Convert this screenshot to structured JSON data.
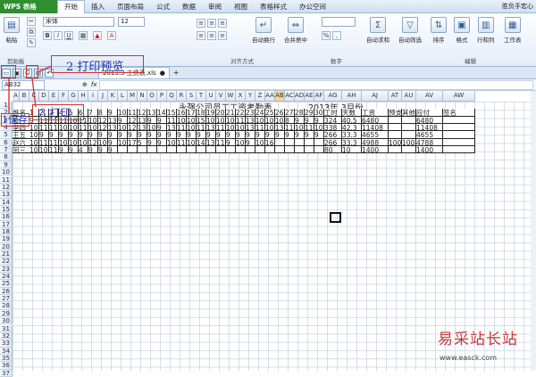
{
  "app": {
    "name": "WPS 表格"
  },
  "menu": {
    "tabs": [
      "开始",
      "插入",
      "页面布局",
      "公式",
      "数据",
      "审阅",
      "视图",
      "表格样式",
      "办公空间"
    ],
    "right": [
      "胜负手宏心"
    ]
  },
  "ribbon": {
    "paste": "粘贴",
    "clipboard_label": "剪贴板",
    "font_name": "宋体",
    "font_size": "12",
    "align_label": "对齐方式",
    "wrap": "自动换行",
    "merge": "合并居中",
    "number_label": "数字",
    "autosum": "自动求和",
    "autofilter": "自动筛选",
    "sort": "排序",
    "format": "格式",
    "rowcol": "行和列",
    "sheet": "工作表",
    "edit_label": "编辑"
  },
  "tabbar": {
    "doc": "2013.3 工资表.xls",
    "add": "+"
  },
  "formula": {
    "namebox": "AB32",
    "fx": "fx"
  },
  "columns": [
    "A",
    "B",
    "C",
    "D",
    "E",
    "F",
    "G",
    "H",
    "I",
    "J",
    "K",
    "L",
    "M",
    "N",
    "O",
    "P",
    "Q",
    "R",
    "S",
    "T",
    "U",
    "V",
    "W",
    "X",
    "Y",
    "Z",
    "AA",
    "AB",
    "AC",
    "AD",
    "AE",
    "AF",
    "AG",
    "AH",
    "AJ",
    "AT",
    "AU",
    "AV",
    "AW"
  ],
  "selected_col": "AB",
  "rows": [
    "1",
    "2",
    "3",
    "4",
    "5",
    "6",
    "7",
    "8",
    "9",
    "10",
    "11",
    "12",
    "13",
    "14",
    "15",
    "16",
    "17",
    "18",
    "19",
    "20",
    "21",
    "22",
    "23",
    "24",
    "25",
    "26",
    "27",
    "28",
    "29",
    "30",
    "31",
    "32",
    "33",
    "34",
    "35",
    "36",
    "37"
  ],
  "sheet": {
    "title": "永强公司员工工资考勤表",
    "period": "2013年 3月份",
    "header": [
      "姓名",
      "1",
      "2",
      "3",
      "4",
      "5",
      "6",
      "7",
      "8",
      "9",
      "10",
      "11",
      "12",
      "13",
      "14",
      "15",
      "16",
      "17",
      "18",
      "19",
      "20",
      "21",
      "22",
      "23",
      "24",
      "25",
      "26",
      "27",
      "28",
      "29",
      "30",
      "31",
      "工时",
      "天数",
      "工资",
      "预支",
      "其他",
      "应付",
      "签名"
    ],
    "records": [
      {
        "name": "张三",
        "days": "9 11 11 11 10 11 10 12 13 9 12 13 9 9 11 10 10 15 10 10 10 11 13 10 10 10 8 9 9 9 12",
        "hours": "324",
        "d": "40.5",
        "pay": "6480",
        "adv": "",
        "oth": "",
        "due": "6480"
      },
      {
        "name": "李四",
        "days": "10 11 11 10 10 11 10 12 13 10 12 13 10 9 13 11 10 11 13 11 10 10 13 11 10 13 11 10 11 10 12",
        "hours": "338",
        "d": "42.3",
        "pay": "11408",
        "adv": "",
        "oth": "",
        "due": "11408"
      },
      {
        "name": "王五",
        "days": "10 9 9 9 9 9 9 9 9 9 9 9 9 9 9 9 9 9 9 9 9 9 9 9 9 9 9 9 9 9 9",
        "hours": "266",
        "d": "33.3",
        "pay": "4655",
        "adv": "",
        "oth": "",
        "due": "4655"
      },
      {
        "name": "赵六",
        "days": "10 11 11 10 10 10 12 10 9 10 17 5 9 9 10 11 10 14 13 11 9 10 9 10 16",
        "hours": "266",
        "d": "33.3",
        "pay": "4988",
        "adv": "100",
        "oth": "100",
        "due": "4788"
      },
      {
        "name": "阿三",
        "days": "10 10 11 9 9 4 9 9 9",
        "hours": "80",
        "d": "10",
        "pay": "1400",
        "adv": "",
        "oth": "",
        "due": "1400"
      }
    ]
  },
  "annotations": {
    "a1": "1保存",
    "a2": "2 打印预览",
    "a3": "3 打印"
  },
  "watermark": {
    "text": "易采站长站",
    "url": "www.easck.com"
  },
  "colors": {
    "app_green": "#2f8f2f",
    "annotation_red": "#d03030",
    "annotation_blue": "#2233aa"
  }
}
